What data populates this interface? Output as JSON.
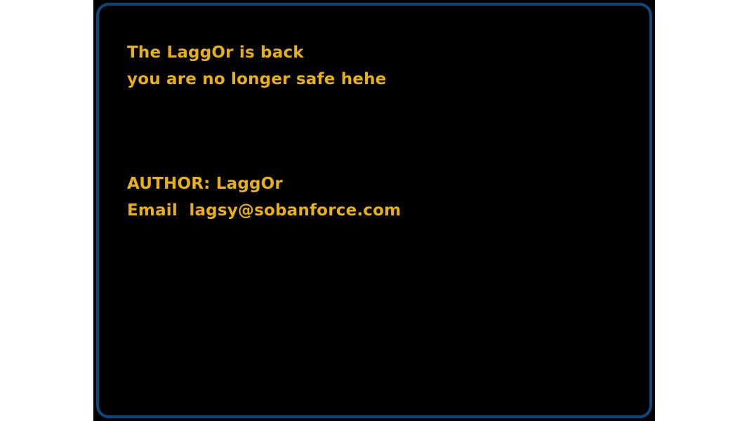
{
  "colors": {
    "text": "#e8b010",
    "border": "#0a4a80",
    "screen_background": "#000000",
    "page_background": "#ffffff"
  },
  "message": {
    "line1": "The LaggOr is back",
    "line2": "you are no longer safe hehe"
  },
  "credits": {
    "author": "AUTHOR: LaggOr",
    "email": "Email  lagsy@sobanforce.com"
  }
}
